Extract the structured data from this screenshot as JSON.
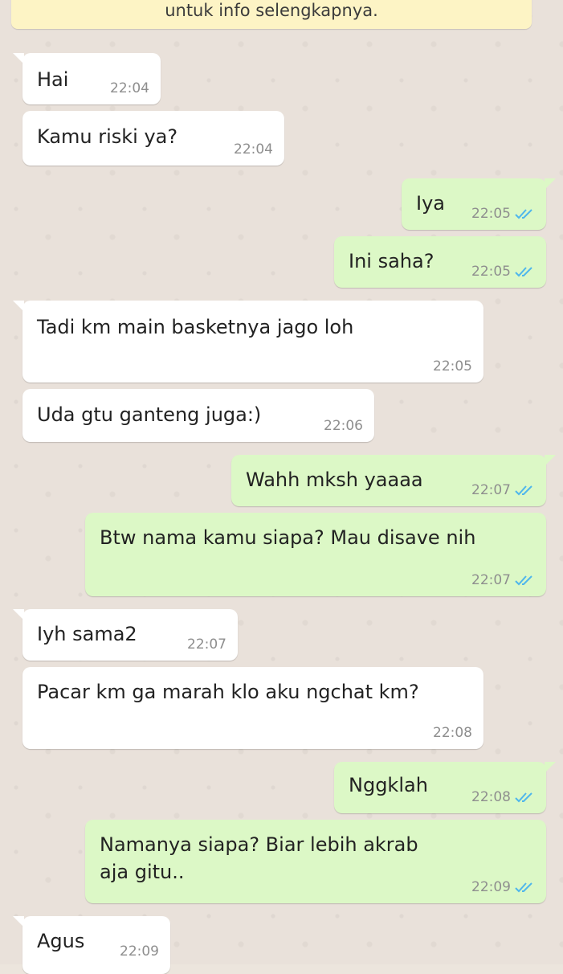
{
  "notice": {
    "text": "untuk info selengkapnya."
  },
  "messages": [
    {
      "dir": "in",
      "text": "Hai",
      "time": "22:04"
    },
    {
      "dir": "in",
      "text": "Kamu riski ya?",
      "time": "22:04"
    },
    {
      "dir": "out",
      "text": "Iya",
      "time": "22:05",
      "status": "read"
    },
    {
      "dir": "out",
      "text": "Ini saha?",
      "time": "22:05",
      "status": "read"
    },
    {
      "dir": "in",
      "text": "Tadi km main basketnya jago loh",
      "time": "22:05"
    },
    {
      "dir": "in",
      "text": "Uda gtu ganteng juga:)",
      "time": "22:06"
    },
    {
      "dir": "out",
      "text": "Wahh mksh yaaaa",
      "time": "22:07",
      "status": "read"
    },
    {
      "dir": "out",
      "text": "Btw nama kamu siapa? Mau disave nih",
      "time": "22:07",
      "status": "read"
    },
    {
      "dir": "in",
      "text": "Iyh sama2",
      "time": "22:07"
    },
    {
      "dir": "in",
      "text": "Pacar km ga marah klo aku ngchat km?",
      "time": "22:08"
    },
    {
      "dir": "out",
      "text": "Nggklah",
      "time": "22:08",
      "status": "read"
    },
    {
      "dir": "out",
      "text": "Namanya siapa? Biar lebih akrab aja gitu..",
      "time": "22:09",
      "status": "read"
    },
    {
      "dir": "in",
      "text": "Agus",
      "time": "22:09"
    }
  ],
  "colors": {
    "incoming_bubble": "#ffffff",
    "outgoing_bubble": "#dcf8c6",
    "read_ticks": "#4fb6ec",
    "notice_bg": "#fdf4c5"
  },
  "icons": {
    "read_receipt": "double-check-icon"
  }
}
